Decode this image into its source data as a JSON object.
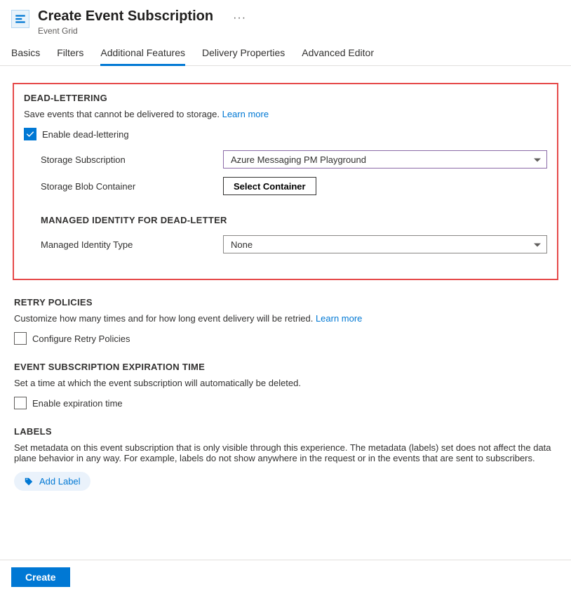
{
  "header": {
    "title": "Create Event Subscription",
    "subtitle": "Event Grid"
  },
  "tabs": [
    {
      "label": "Basics",
      "active": false
    },
    {
      "label": "Filters",
      "active": false
    },
    {
      "label": "Additional Features",
      "active": true
    },
    {
      "label": "Delivery Properties",
      "active": false
    },
    {
      "label": "Advanced Editor",
      "active": false
    }
  ],
  "deadLettering": {
    "title": "DEAD-LETTERING",
    "description": "Save events that cannot be delivered to storage.",
    "learnMore": "Learn more",
    "enableLabel": "Enable dead-lettering",
    "enableChecked": true,
    "storageSubscription": {
      "label": "Storage Subscription",
      "value": "Azure Messaging PM Playground"
    },
    "storageBlobContainer": {
      "label": "Storage Blob Container",
      "button": "Select Container"
    },
    "managedIdentity": {
      "title": "MANAGED IDENTITY FOR DEAD-LETTER",
      "label": "Managed Identity Type",
      "value": "None"
    }
  },
  "retry": {
    "title": "RETRY POLICIES",
    "description": "Customize how many times and for how long event delivery will be retried.",
    "learnMore": "Learn more",
    "configureLabel": "Configure Retry Policies",
    "configureChecked": false
  },
  "expiration": {
    "title": "EVENT SUBSCRIPTION EXPIRATION TIME",
    "description": "Set a time at which the event subscription will automatically be deleted.",
    "enableLabel": "Enable expiration time",
    "enableChecked": false
  },
  "labels": {
    "title": "LABELS",
    "description": "Set metadata on this event subscription that is only visible through this experience. The metadata (labels) set does not affect the data plane behavior in any way. For example, labels do not show anywhere in the request or in the events that are sent to subscribers.",
    "addLabel": "Add Label"
  },
  "footer": {
    "create": "Create"
  }
}
